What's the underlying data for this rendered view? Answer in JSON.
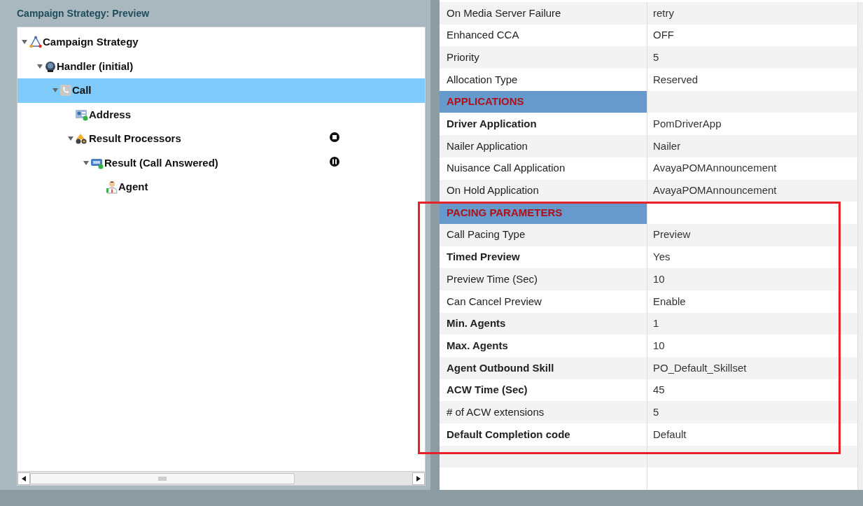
{
  "panel": {
    "title": "Campaign Strategy: Preview"
  },
  "tree": [
    {
      "label": "Campaign Strategy",
      "kind": "strategy",
      "expanded": true,
      "selected": false,
      "children": [
        {
          "label": "Handler (initial)",
          "kind": "handler",
          "expanded": true,
          "selected": false,
          "children": [
            {
              "label": "Call",
              "kind": "call",
              "expanded": true,
              "selected": true,
              "children": [
                {
                  "label": "Address",
                  "kind": "address",
                  "selected": false
                },
                {
                  "label": "Result Processors",
                  "kind": "processors",
                  "expanded": true,
                  "selected": false,
                  "badge": {
                    "kind": "stop"
                  },
                  "children": [
                    {
                      "label": "Result (Call Answered)",
                      "kind": "result",
                      "expanded": true,
                      "selected": false,
                      "badge": {
                        "kind": "pause"
                      },
                      "children": [
                        {
                          "label": "Agent",
                          "kind": "agent",
                          "selected": false
                        }
                      ]
                    }
                  ]
                }
              ]
            }
          ]
        }
      ]
    }
  ],
  "properties": [
    {
      "kind": "row",
      "label": "On Media Server Failure",
      "value": "retry",
      "bold": false
    },
    {
      "kind": "row",
      "label": "Enhanced CCA",
      "value": "OFF",
      "bold": false
    },
    {
      "kind": "row",
      "label": "Priority",
      "value": "5",
      "bold": false
    },
    {
      "kind": "row",
      "label": "Allocation Type",
      "value": "Reserved",
      "bold": false
    },
    {
      "kind": "section",
      "label": "APPLICATIONS"
    },
    {
      "kind": "row",
      "label": "Driver Application",
      "value": "PomDriverApp",
      "bold": true
    },
    {
      "kind": "row",
      "label": "Nailer Application",
      "value": "Nailer",
      "bold": false
    },
    {
      "kind": "row",
      "label": "Nuisance Call Application",
      "value": "AvayaPOMAnnouncement",
      "bold": false
    },
    {
      "kind": "row",
      "label": "On Hold Application",
      "value": "AvayaPOMAnnouncement",
      "bold": false
    },
    {
      "kind": "section",
      "label": "PACING PARAMETERS"
    },
    {
      "kind": "row",
      "label": "Call Pacing Type",
      "value": "Preview",
      "bold": false
    },
    {
      "kind": "row",
      "label": "Timed Preview",
      "value": "Yes",
      "bold": true
    },
    {
      "kind": "row",
      "label": "Preview Time (Sec)",
      "value": "10",
      "bold": false
    },
    {
      "kind": "row",
      "label": "Can Cancel Preview",
      "value": "Enable",
      "bold": false
    },
    {
      "kind": "row",
      "label": "Min. Agents",
      "value": "1",
      "bold": true
    },
    {
      "kind": "row",
      "label": "Max. Agents",
      "value": "10",
      "bold": true
    },
    {
      "kind": "row",
      "label": "Agent Outbound Skill",
      "value": "PO_Default_Skillset",
      "bold": true
    },
    {
      "kind": "row",
      "label": "ACW Time (Sec)",
      "value": "45",
      "bold": true
    },
    {
      "kind": "row",
      "label": "# of ACW extensions",
      "value": "5",
      "bold": false
    },
    {
      "kind": "row",
      "label": "Default Completion code",
      "value": "Default",
      "bold": true
    },
    {
      "kind": "empty"
    },
    {
      "kind": "empty"
    }
  ]
}
